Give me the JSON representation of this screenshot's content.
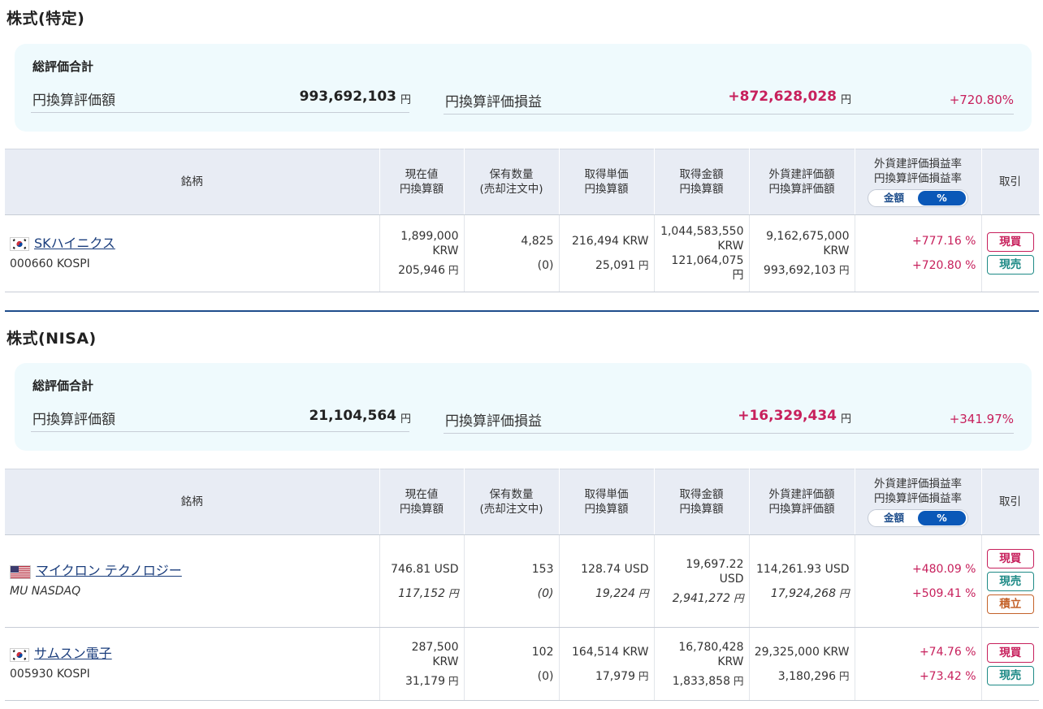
{
  "sections": [
    {
      "title": "株式(特定)",
      "summary": {
        "title": "総評価合計",
        "valuation_label": "円換算評価額",
        "valuation_value": "993,692,103",
        "valuation_unit": "円",
        "gain_label": "円換算評価損益",
        "gain_value": "+872,628,028",
        "gain_unit": "円",
        "gain_pct": "+720.80%"
      },
      "rows": [
        {
          "flag": "kr-flag-icon",
          "name": "SKハイニクス",
          "code": "000660 KOSPI",
          "price": "1,899,000\nKRW",
          "price_yen": "205,946",
          "qty": "4,825",
          "qty_pending": "(0)",
          "unit_cost": "216,494 KRW",
          "unit_cost_yen": "25,091",
          "cost": "1,044,583,550\nKRW",
          "cost_yen": "121,064,075\n円",
          "valuation": "9,162,675,000\nKRW",
          "valuation_yen": "993,692,103",
          "pct_foreign": "+777.16 %",
          "pct_yen": "+720.80 %",
          "buttons": [
            "現買",
            "現売"
          ]
        }
      ]
    },
    {
      "title": "株式(NISA)",
      "summary": {
        "title": "総評価合計",
        "valuation_label": "円換算評価額",
        "valuation_value": "21,104,564",
        "valuation_unit": "円",
        "gain_label": "円換算評価損益",
        "gain_value": "+16,329,434",
        "gain_unit": "円",
        "gain_pct": "+341.97%"
      },
      "rows": [
        {
          "flag": "us-flag-icon",
          "name": "マイクロン テクノロジー",
          "code": "MU NASDAQ",
          "price": "746.81 USD",
          "price_yen": "117,152",
          "qty": "153",
          "qty_pending": "(0)",
          "unit_cost": "128.74 USD",
          "unit_cost_yen": "19,224",
          "cost": "19,697.22\nUSD",
          "cost_yen": "2,941,272",
          "valuation": "114,261.93 USD",
          "valuation_yen": "17,924,268",
          "pct_foreign": "+480.09 %",
          "pct_yen": "+509.41 %",
          "buttons": [
            "現買",
            "現売",
            "積立"
          ]
        },
        {
          "flag": "kr-flag-icon",
          "name": "サムスン電子",
          "code": "005930 KOSPI",
          "price": "287,500\nKRW",
          "price_yen": "31,179",
          "qty": "102",
          "qty_pending": "(0)",
          "unit_cost": "164,514 KRW",
          "unit_cost_yen": "17,979",
          "cost": "16,780,428\nKRW",
          "cost_yen": "1,833,858",
          "valuation": "29,325,000 KRW",
          "valuation_yen": "3,180,296",
          "pct_foreign": "+74.76 %",
          "pct_yen": "+73.42 %",
          "buttons": [
            "現買",
            "現売"
          ]
        }
      ]
    }
  ],
  "table_headers": {
    "name": "銘柄",
    "price": "現在値\n円換算額",
    "qty": "保有数量\n(売却注文中)",
    "unit_cost": "取得単価\n円換算額",
    "cost": "取得金額\n円換算額",
    "valuation": "外貨建評価額\n円換算評価額",
    "pct": "外貨建評価損益率\n円換算評価損益率",
    "toggle_amount": "金額",
    "toggle_pct": "%",
    "trade": "取引"
  },
  "yen_unit": "円",
  "colors": {
    "positive": "#c7205c",
    "link": "#1a3d7c",
    "summary_bg": "#effafd",
    "header_bg": "#e8ecf4",
    "toggle_active": "#0a58b8",
    "buy_button": "#c7205c",
    "sell_button": "#1e8a86",
    "tsumitate_button": "#c4622a"
  }
}
